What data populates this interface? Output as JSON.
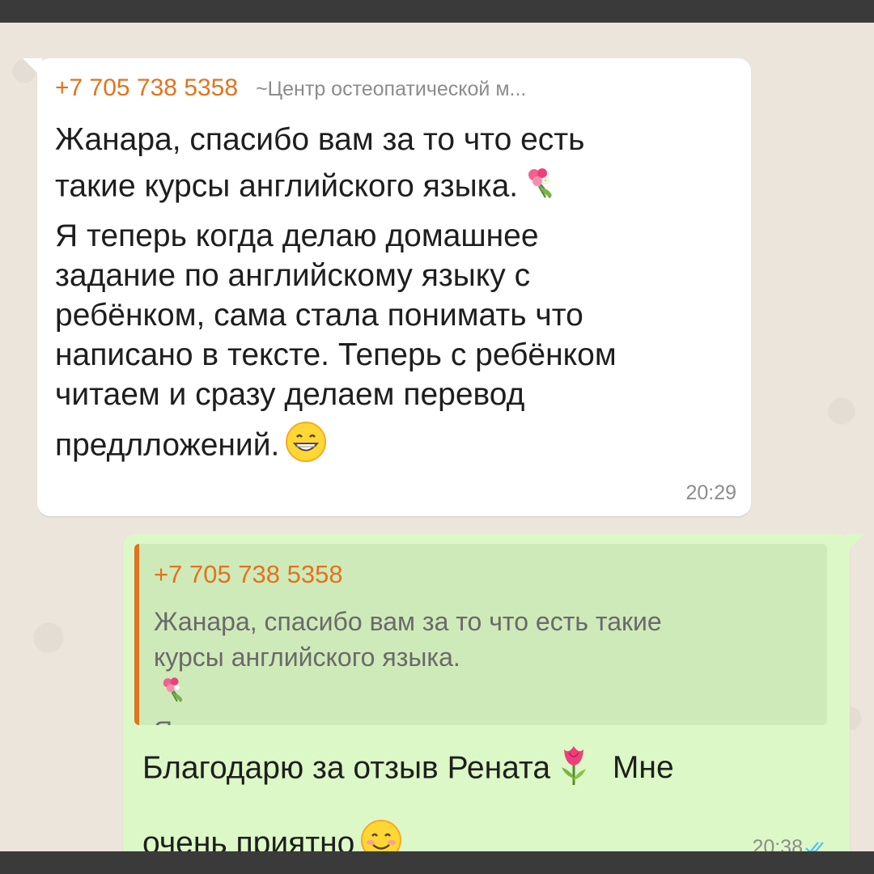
{
  "incoming": {
    "sender_phone": "+7 705 738 5358",
    "sender_name": "~Центр остеопатической м...",
    "lines": [
      "Жанара, спасибо вам за то что есть",
      "такие курсы английского языка.",
      "Я теперь когда делаю домашнее",
      "задание по  английскому  языку с",
      "ребёнком, сама стала понимать что",
      "написано в тексте. Теперь с ребёнком",
      "читаем и сразу делаем перевод",
      "предлложений."
    ],
    "time": "20:29",
    "emojis": [
      "bouquet-emoji",
      "grin-emoji"
    ]
  },
  "outgoing": {
    "quote": {
      "author": "+7 705 738 5358",
      "lines": [
        "Жанара, спасибо вам за то что есть такие",
        "курсы английского языка.",
        "Я теперь когда делаю домашнее задание..."
      ]
    },
    "reply_lines": [
      "Благодарю за отзыв Рената",
      "Мне",
      "очень приятно"
    ],
    "time": "20:38",
    "status": "read",
    "emojis": [
      "tulip-emoji",
      "smile-emoji"
    ]
  },
  "colors": {
    "accent_orange": "#e0741f",
    "wallpaper": "#ece5dc",
    "outgoing_bubble": "#dcf8c6",
    "quote_bg": "#cfeab9",
    "read_ticks": "#4fc3f7"
  }
}
